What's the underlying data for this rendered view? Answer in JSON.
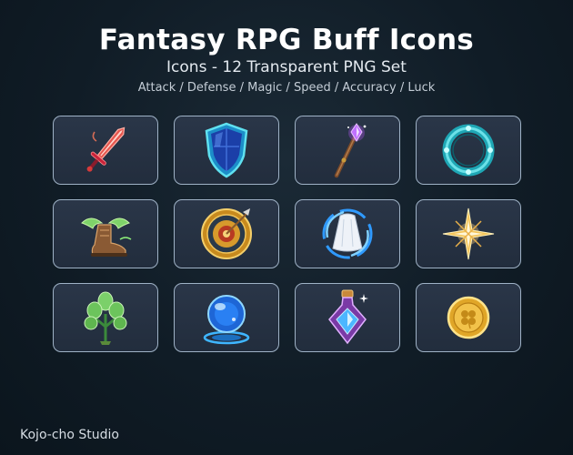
{
  "header": {
    "title": "Fantasy RPG Buff Icons",
    "subtitle": "Icons - 12 Transparent PNG Set",
    "tags": "Attack / Defense / Magic / Speed / Accuracy / Luck"
  },
  "icons": [
    {
      "icon": "flaming-sword-icon"
    },
    {
      "icon": "blue-shield-icon"
    },
    {
      "icon": "crystal-staff-icon"
    },
    {
      "icon": "cyan-ring-icon"
    },
    {
      "icon": "winged-boot-icon"
    },
    {
      "icon": "target-arrow-icon"
    },
    {
      "icon": "wind-cloak-icon"
    },
    {
      "icon": "star-sparkle-icon"
    },
    {
      "icon": "herb-plant-icon"
    },
    {
      "icon": "crystal-orb-icon"
    },
    {
      "icon": "potion-bottle-icon"
    },
    {
      "icon": "clover-coin-icon"
    }
  ],
  "footer": {
    "brand": "Kojo-cho Studio"
  }
}
